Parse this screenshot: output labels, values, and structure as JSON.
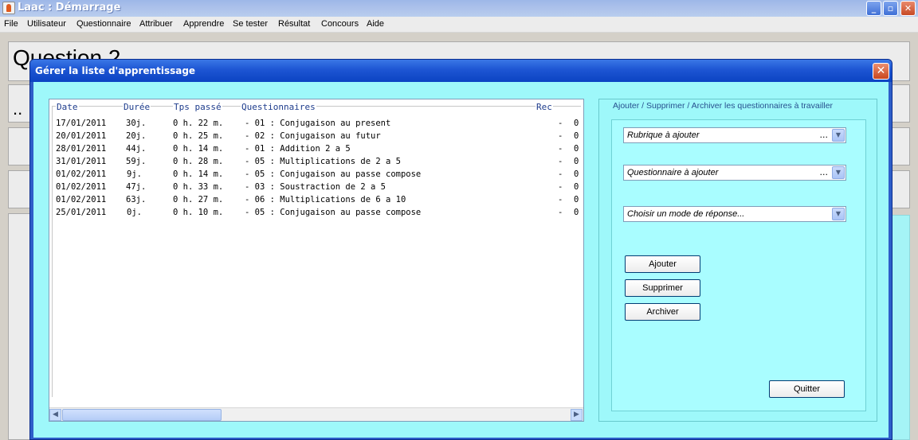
{
  "window": {
    "title": "Laac : Démarrage"
  },
  "menu": [
    "File",
    "Utilisateur",
    "Questionnaire",
    "Attribuer",
    "Apprendre",
    "Se tester",
    "Résultat",
    "Concours",
    "Aide"
  ],
  "background": {
    "heading": "Question 2",
    "dots": ".."
  },
  "dialog": {
    "title": "Gérer la liste d'apprentissage",
    "list": {
      "headers": [
        "Date",
        "Durée",
        "Tps passé",
        "Questionnaires",
        "Rec"
      ],
      "rows": [
        [
          "17/01/2011",
          "30j.",
          "0 h. 22 m.",
          "- 01 : Conjugaison au present",
          "-",
          "0"
        ],
        [
          "20/01/2011",
          "20j.",
          "0 h. 25 m.",
          "- 02 : Conjugaison au futur",
          "-",
          "0"
        ],
        [
          "28/01/2011",
          "44j.",
          "0 h. 14 m.",
          "- 01 : Addition 2 a 5",
          "-",
          "0"
        ],
        [
          "31/01/2011",
          "59j.",
          "0 h. 28 m.",
          "- 05 : Multiplications de 2 a 5",
          "-",
          "0"
        ],
        [
          "01/02/2011",
          "9j.",
          "0 h. 14 m.",
          "- 05 : Conjugaison au passe compose",
          "-",
          "0"
        ],
        [
          "01/02/2011",
          "47j.",
          "0 h. 33 m.",
          "- 03 : Soustraction de 2 a 5",
          "-",
          "0"
        ],
        [
          "01/02/2011",
          "63j.",
          "0 h. 27 m.",
          "- 06 : Multiplications de 6 a 10",
          "-",
          "0"
        ],
        [
          "25/01/2011",
          "0j.",
          "0 h. 10 m.",
          "- 05 : Conjugaison au passe compose",
          "-",
          "0"
        ]
      ]
    },
    "panel": {
      "legend": "Ajouter / Supprimer / Archiver les questionnaires à travailler",
      "rubrique": "Rubrique à ajouter",
      "questionnaire": "Questionnaire à ajouter",
      "mode": "Choisir un mode de réponse...",
      "ellipsis": "...",
      "buttons": {
        "ajouter": "Ajouter",
        "supprimer": "Supprimer",
        "archiver": "Archiver",
        "quitter": "Quitter"
      }
    }
  }
}
